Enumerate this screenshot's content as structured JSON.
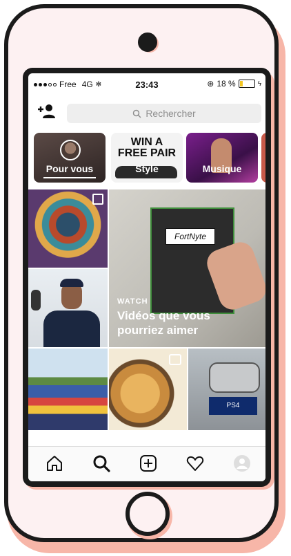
{
  "status_bar": {
    "carrier": "Free",
    "network": "4G",
    "time": "23:43",
    "battery_percent": "18 %",
    "battery_level": 0.18,
    "battery_color": "#f3c623"
  },
  "search": {
    "placeholder": "Rechercher",
    "icon": "search-icon"
  },
  "header": {
    "add_user_icon": "add-user-icon"
  },
  "categories": [
    {
      "label": "Pour vous"
    },
    {
      "label": "Style",
      "banner_text": "WIN A\nFREE PAIR"
    },
    {
      "label": "Musique"
    }
  ],
  "featured": {
    "label": "WATCH",
    "caption": "Vidéos que vous pourriez aimer",
    "box_label": "FortNyte"
  },
  "grid_tiles": [
    {
      "name": "graffiti-portrait"
    },
    {
      "name": "man-with-cap"
    },
    {
      "name": "graffiti-wall"
    },
    {
      "name": "food-video",
      "icon": "reel-icon"
    },
    {
      "name": "ps4-controller",
      "label": "PS4"
    }
  ],
  "bottom_nav": [
    {
      "icon": "home-icon"
    },
    {
      "icon": "search-icon"
    },
    {
      "icon": "add-post-icon"
    },
    {
      "icon": "heart-icon"
    },
    {
      "icon": "profile-icon"
    }
  ],
  "colors": {
    "frame_accent": "#f7b6a8",
    "frame_outline": "#1b1b1b",
    "phone_body": "#fdf1f2"
  }
}
